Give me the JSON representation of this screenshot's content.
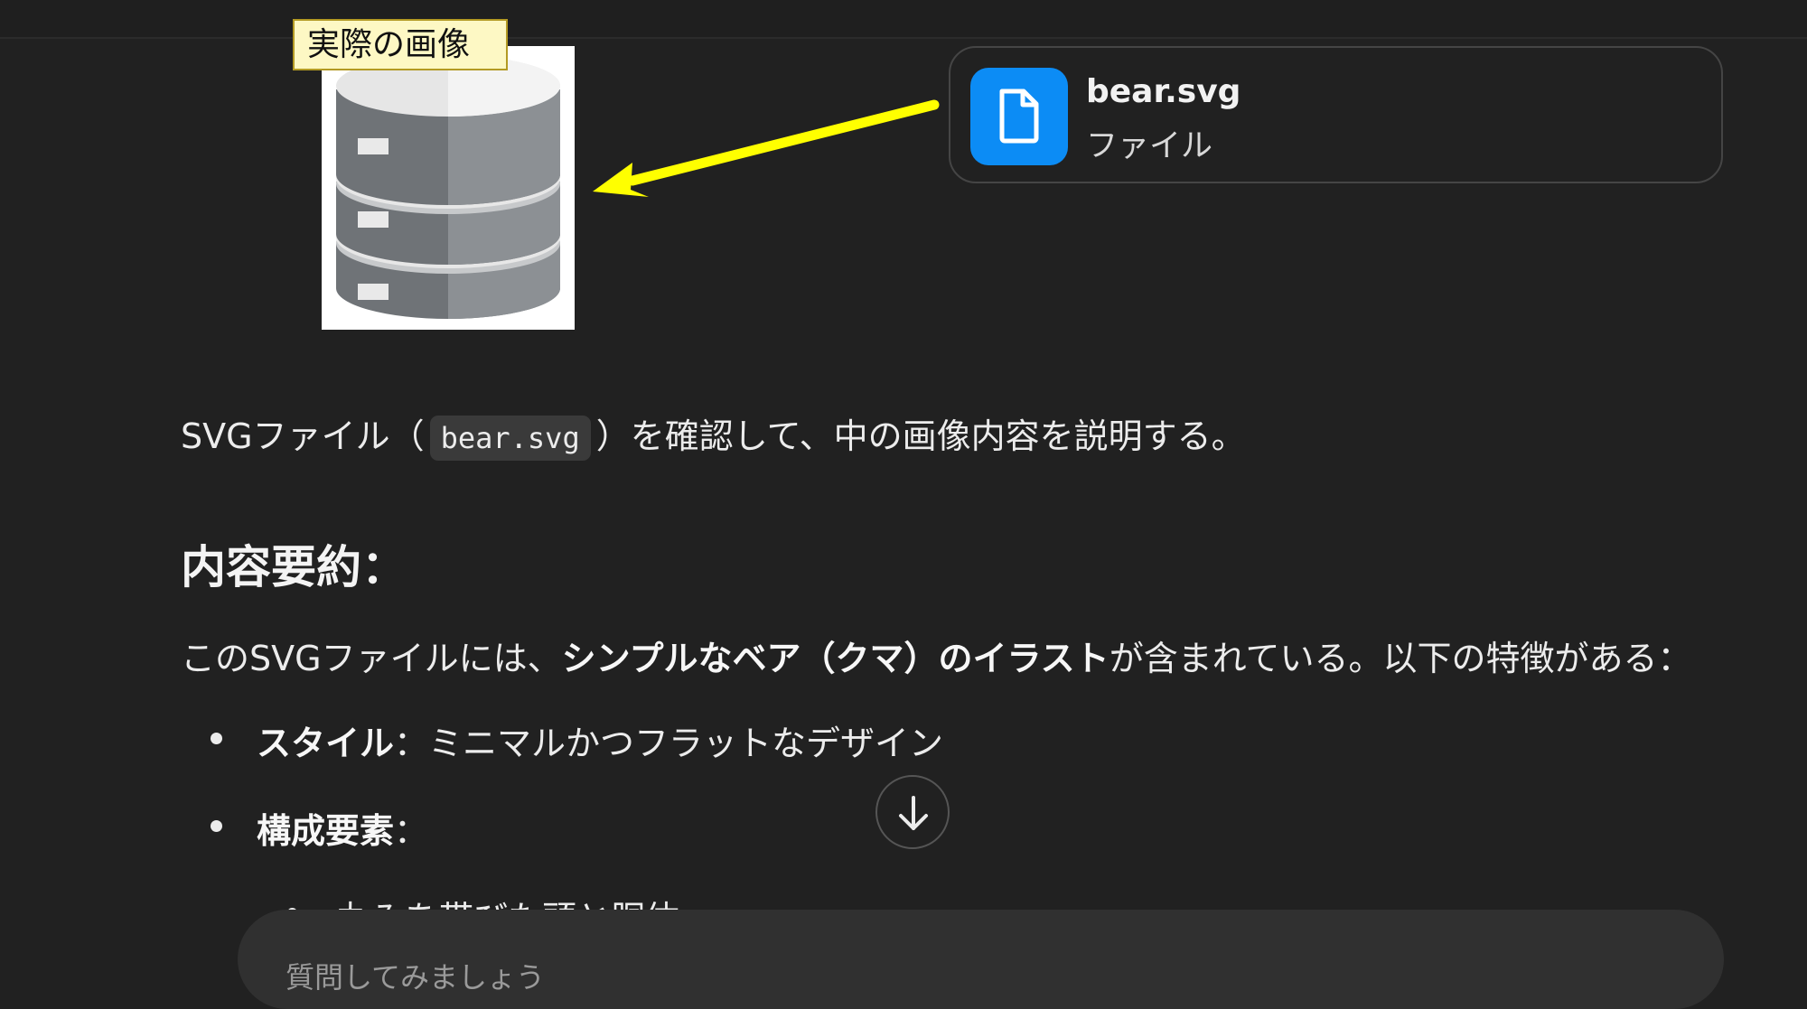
{
  "annotation": {
    "label": "実際の画像"
  },
  "attachment": {
    "file_name": "bear.svg",
    "file_type": "ファイル"
  },
  "message": {
    "intro_before": "SVGファイル（",
    "intro_code": "bear.svg",
    "intro_after": "）を確認して、中の画像内容を説明する。",
    "heading": "内容要約：",
    "summary_before": "このSVGファイルには、",
    "summary_bold": "シンプルなベア（クマ）のイラスト",
    "summary_after": "が含まれている。以下の特徴がある：",
    "bullets": [
      {
        "label": "スタイル",
        "text": "：ミニマルかつフラットなデザイン"
      },
      {
        "label": "構成要素",
        "text": "："
      }
    ],
    "sub_bullets": [
      "丸みを帯びた頭と胴体"
    ]
  },
  "composer": {
    "placeholder": "質問してみましょう"
  },
  "icons": {
    "file": "file-icon",
    "scroll": "arrow-down-icon",
    "image": "database-icon"
  },
  "colors": {
    "background": "#212121",
    "file_icon_bg": "#0c8cf5",
    "arrow": "#ffff00",
    "note_bg": "#fdf8c4"
  }
}
